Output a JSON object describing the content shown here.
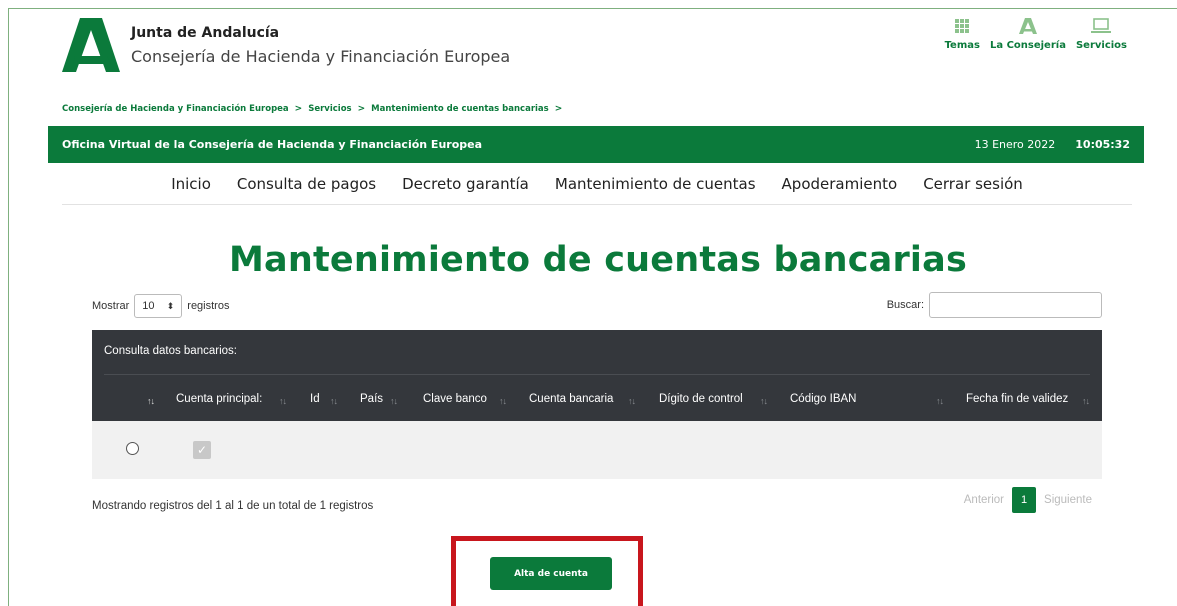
{
  "header": {
    "org_name": "Junta de Andalucía",
    "org_sub": "Consejería de Hacienda y Financiación Europea",
    "nav": [
      {
        "label": "Temas",
        "icon": "grid-icon"
      },
      {
        "label": "La Consejería",
        "icon": "andalucia-a-icon"
      },
      {
        "label": "Servicios",
        "icon": "laptop-icon"
      }
    ]
  },
  "breadcrumb": [
    "Consejería de Hacienda y Financiación Europea",
    "Servicios",
    "Mantenimiento de cuentas bancarias"
  ],
  "breadcrumb_sep": ">",
  "greenbar": {
    "title": "Oficina Virtual de la Consejería de Hacienda y Financiación Europea",
    "date": "13 Enero 2022",
    "time": "10:05:32"
  },
  "main_nav": [
    "Inicio",
    "Consulta de pagos",
    "Decreto garantía",
    "Mantenimiento de cuentas",
    "Apoderamiento",
    "Cerrar sesión"
  ],
  "page_title": "Mantenimiento de cuentas bancarias",
  "table": {
    "show_label": "Mostrar",
    "page_size": "10",
    "records_label": "registros",
    "search_label": "Buscar:",
    "search_value": "",
    "caption": "Consulta datos bancarios:",
    "columns": [
      "Cuenta principal:",
      "Id",
      "País",
      "Clave banco",
      "Cuenta bancaria",
      "Dígito de control",
      "Código IBAN",
      "Fecha fin de validez"
    ],
    "sort_icon": "↑↓",
    "rows": [
      {
        "selected": false,
        "principal": true
      }
    ],
    "info": "Mostrando registros del 1 al 1 de un total de 1 registros",
    "pager": {
      "prev": "Anterior",
      "current": "1",
      "next": "Siguiente"
    }
  },
  "add_button": "Alta de cuenta",
  "colors": {
    "brand_green": "#0b7a3b",
    "table_header": "#34373c",
    "highlight_red": "#c8161d"
  }
}
